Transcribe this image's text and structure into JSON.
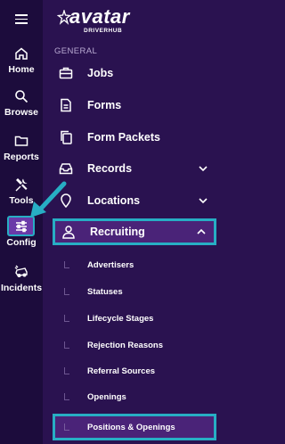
{
  "brand": {
    "name": "avatar",
    "sub": "DRIVERHUB"
  },
  "rail": {
    "items": [
      {
        "label": "Home",
        "icon": "home-icon"
      },
      {
        "label": "Browse",
        "icon": "search-icon"
      },
      {
        "label": "Reports",
        "icon": "folder-icon"
      },
      {
        "label": "Tools",
        "icon": "tools-icon"
      },
      {
        "label": "Config",
        "icon": "sliders-icon"
      },
      {
        "label": "Incidents",
        "icon": "car-crash-icon"
      }
    ]
  },
  "menu": {
    "section": "GENERAL",
    "items": [
      {
        "label": "Jobs",
        "icon": "briefcase-icon"
      },
      {
        "label": "Forms",
        "icon": "document-icon"
      },
      {
        "label": "Form Packets",
        "icon": "copy-icon"
      },
      {
        "label": "Records",
        "icon": "inbox-icon"
      },
      {
        "label": "Locations",
        "icon": "map-pin-icon"
      },
      {
        "label": "Recruiting",
        "icon": "user-icon"
      }
    ],
    "sub_items": [
      "Advertisers",
      "Statuses",
      "Lifecycle Stages",
      "Rejection Reasons",
      "Referral Sources",
      "Openings",
      "Positions & Openings"
    ]
  },
  "colors": {
    "rail_bg": "#1c0c3c",
    "panel_bg": "#2a1250",
    "highlight": "#27aec4",
    "active_bg": "#4a2378"
  }
}
